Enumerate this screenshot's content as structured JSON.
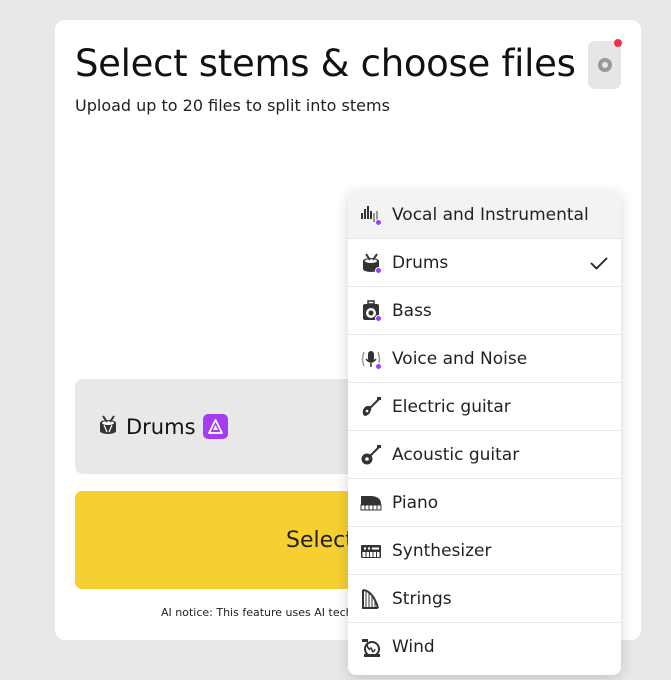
{
  "page": {
    "title": "Select stems & choose files",
    "subtitle": "Upload up to 20 files to split into stems"
  },
  "stem_select": {
    "selected_label": "Drums",
    "icon": "drum-icon",
    "badge_icon": "ai-badge-icon"
  },
  "actions": {
    "select_files_label": "Select"
  },
  "notice": {
    "text": "AI notice: This feature uses AI tech"
  },
  "dropdown": {
    "items": [
      {
        "label": "Vocal and Instrumental",
        "icon": "soundwave-icon",
        "premium": true,
        "selected": false
      },
      {
        "label": "Drums",
        "icon": "drum-icon",
        "premium": true,
        "selected": true
      },
      {
        "label": "Bass",
        "icon": "bass-amp-icon",
        "premium": true,
        "selected": false
      },
      {
        "label": "Voice and Noise",
        "icon": "microphone-icon",
        "premium": true,
        "selected": false
      },
      {
        "label": "Electric guitar",
        "icon": "electric-guitar-icon",
        "premium": false,
        "selected": false
      },
      {
        "label": "Acoustic guitar",
        "icon": "acoustic-guitar-icon",
        "premium": false,
        "selected": false
      },
      {
        "label": "Piano",
        "icon": "piano-icon",
        "premium": false,
        "selected": false
      },
      {
        "label": "Synthesizer",
        "icon": "synthesizer-icon",
        "premium": false,
        "selected": false
      },
      {
        "label": "Strings",
        "icon": "harp-icon",
        "premium": false,
        "selected": false
      },
      {
        "label": "Wind",
        "icon": "horn-icon",
        "premium": false,
        "selected": false
      }
    ]
  },
  "colors": {
    "accent_yellow": "#f5d030",
    "premium_purple": "#a63cf2",
    "notification_red": "#f0324b"
  }
}
